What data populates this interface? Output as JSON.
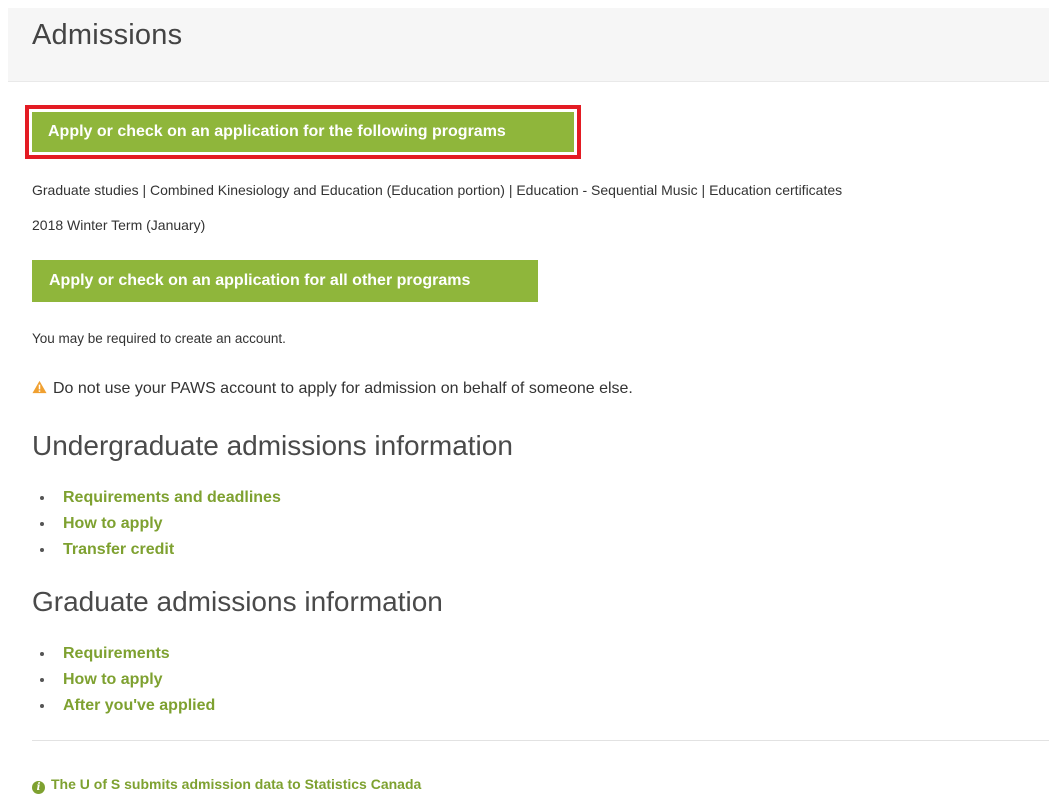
{
  "header": {
    "title": "Admissions"
  },
  "apply_primary": {
    "label": "Apply or check on an application for the following programs"
  },
  "programs_list": "Graduate studies | Combined Kinesiology and Education (Education portion) | Education - Sequential Music | Education certificates",
  "term": "2018 Winter Term (January)",
  "apply_secondary": {
    "label": "Apply or check on an application for all other programs"
  },
  "account_note": "You may be required to create an account.",
  "warning": {
    "icon": "warning-triangle-icon",
    "color": "#f0a030",
    "text": "Do not use your PAWS account to apply for admission on behalf of someone else."
  },
  "undergrad": {
    "heading": "Undergraduate admissions information",
    "links": [
      "Requirements and deadlines",
      "How to apply",
      "Transfer credit"
    ]
  },
  "grad": {
    "heading": "Graduate admissions information",
    "links": [
      "Requirements",
      "How to apply",
      "After you've applied"
    ]
  },
  "footer_note": {
    "icon": "info-circle-icon",
    "text": "The U of S submits admission data to Statistics Canada"
  },
  "colors": {
    "button_green": "#8fb63b",
    "link_green": "#7ea130",
    "highlight_red": "#e31b23"
  }
}
